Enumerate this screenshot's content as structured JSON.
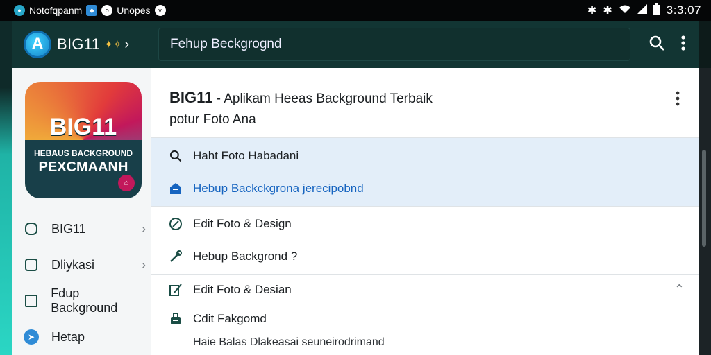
{
  "status_bar": {
    "notif_label_1": "Notofqpanm",
    "notif_label_2": "Unopes",
    "clock": "3:3:07"
  },
  "app_bar": {
    "logo_letter": "A",
    "brand": "BIG11",
    "search_text": "Fehup Beckgrognd"
  },
  "sidebar": {
    "app_icon": {
      "title": "BIG11",
      "subtitle": "HEBAUS BACKGROUND",
      "bottom": "PEXCMAANH"
    },
    "items": [
      {
        "label": "BIG11",
        "icon": "face-icon",
        "has_chevron": true
      },
      {
        "label": "Dliykasi",
        "icon": "bag-icon",
        "has_chevron": true
      },
      {
        "label": "Fdup Background",
        "icon": "folder-icon",
        "has_chevron": false
      },
      {
        "label": "Hetap",
        "icon": "help-icon",
        "has_chevron": false
      }
    ]
  },
  "main": {
    "title_bold": "BIG11",
    "title_rest": " - Aplikam Heeas Background Terbaik",
    "title_line2": "potur Foto Ana",
    "rows": [
      {
        "label": "Haht Foto Habadani",
        "icon": "search-icon"
      },
      {
        "label": "Hebup Backckgrona jerecipobnd",
        "icon": "home-icon"
      },
      {
        "label": "Edit Foto & Design",
        "icon": "edit-icon"
      },
      {
        "label": "Hebup Backgrond ?",
        "icon": "link-icon"
      },
      {
        "label": "Edit Foto & Desian",
        "icon": "image-edit-icon"
      },
      {
        "label": "Cdit Fakgomd",
        "icon": "lock-icon"
      }
    ],
    "footer_text": "Haie Balas Dlakeasai seuneirodrimand"
  },
  "colors": {
    "appbar_bg": "#123533",
    "highlight_bg": "#e3eef9",
    "link_blue": "#1664c0",
    "accent_teal": "#2bd6c4"
  }
}
